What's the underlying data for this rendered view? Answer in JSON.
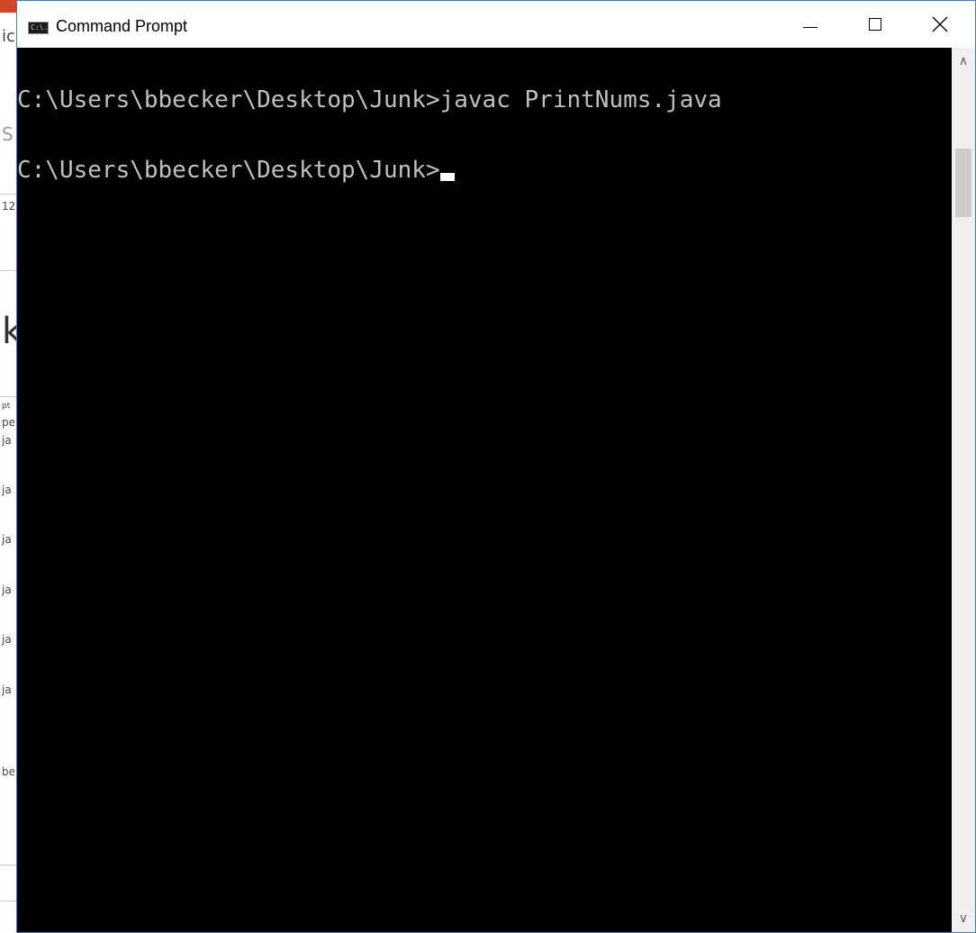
{
  "background_app": {
    "fragments": [
      "ic",
      "S",
      "12",
      "k",
      "pt",
      "pe",
      "ja",
      "ja",
      "ja",
      "ja",
      "ja",
      "ja",
      "be"
    ]
  },
  "window": {
    "title": "Command Prompt",
    "icon": "console-icon",
    "icon_text": "C:\\.",
    "close_glyph": "✕",
    "accent_color": "#3a7bd5"
  },
  "console": {
    "lines": [
      "",
      "C:\\Users\\bbecker\\Desktop\\Junk>javac PrintNums.java",
      "",
      "C:\\Users\\bbecker\\Desktop\\Junk>"
    ],
    "background_color": "#000000",
    "text_color": "#c0c0c0"
  },
  "scrollbar": {
    "up_glyph": "∧",
    "down_glyph": "∨"
  }
}
